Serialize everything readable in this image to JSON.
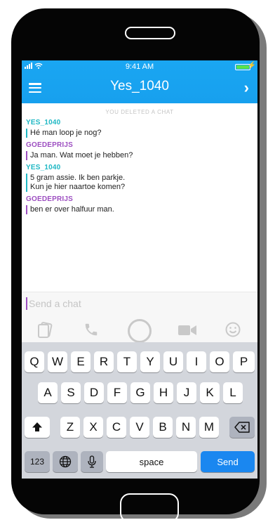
{
  "status_bar": {
    "time": "9:41 AM"
  },
  "header": {
    "title": "Yes_1040"
  },
  "system_note": "YOU DELETED A CHAT",
  "messages": [
    {
      "sender": "YES_1040",
      "text": "Hé man loop je nog?"
    },
    {
      "sender": "GOEDEPRIJS",
      "text": "Ja man. Wat moet je hebben?"
    },
    {
      "sender": "YES_1040",
      "text": "5 gram assie. Ik ben parkje.\nKun je hier naartoe komen?"
    },
    {
      "sender": "GOEDEPRIJS",
      "text": "ben er over halfuur man."
    }
  ],
  "composer": {
    "placeholder": "Send a chat",
    "value": ""
  },
  "colors": {
    "header": "#17a0ee",
    "sender_a": "#1fb8c4",
    "sender_b": "#9d4fc1",
    "send_key": "#1a87f0"
  },
  "icons": [
    "menu-icon",
    "chevron-right-icon",
    "sticker-icon",
    "phone-icon",
    "video-camera-icon",
    "emoji-icon",
    "shift-icon",
    "backspace-icon",
    "globe-icon",
    "microphone-icon"
  ],
  "keyboard": {
    "row1": [
      "Q",
      "W",
      "E",
      "R",
      "T",
      "Y",
      "U",
      "I",
      "O",
      "P"
    ],
    "row2": [
      "A",
      "S",
      "D",
      "F",
      "G",
      "H",
      "J",
      "K",
      "L"
    ],
    "row3": [
      "Z",
      "X",
      "C",
      "V",
      "B",
      "N",
      "M"
    ],
    "numbers_label": "123",
    "space_label": "space",
    "send_label": "Send"
  }
}
